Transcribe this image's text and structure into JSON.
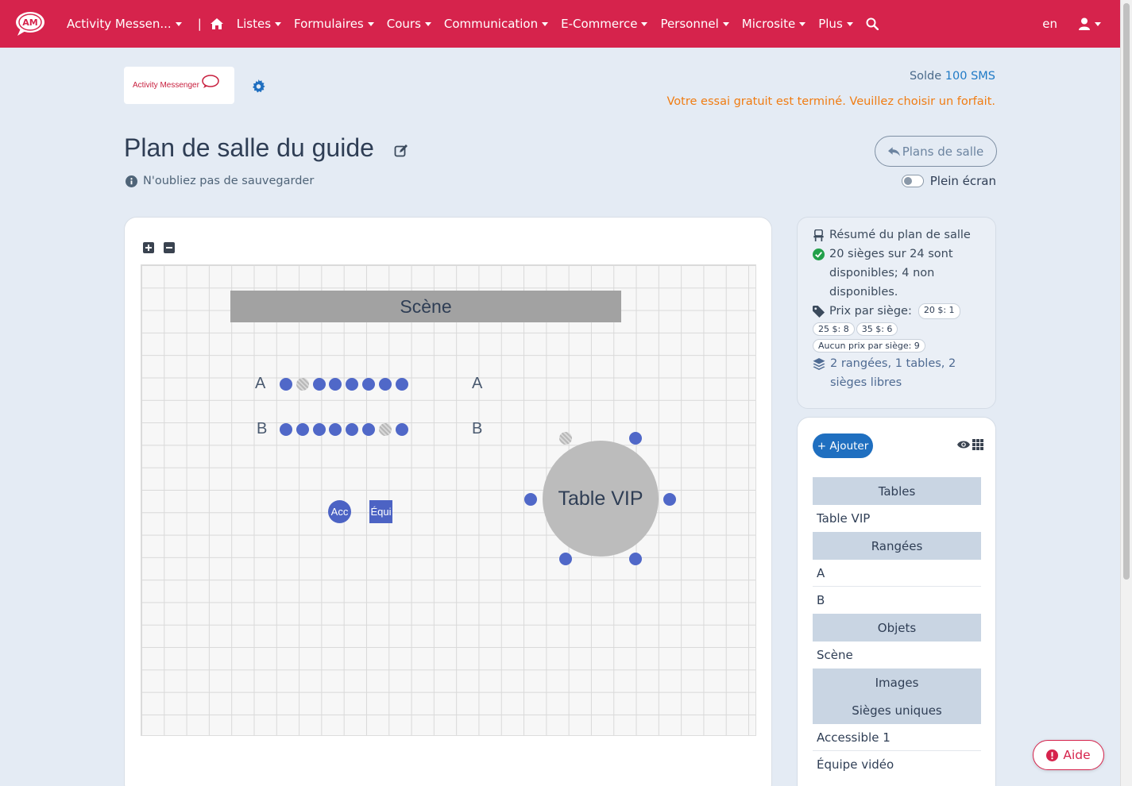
{
  "nav": {
    "logo_text": "AM",
    "app_name": "Activity Messen...",
    "separator": "|",
    "items": [
      "Listes",
      "Formulaires",
      "Cours",
      "Communication",
      "E-Commerce",
      "Personnel",
      "Microsite",
      "Plus"
    ],
    "lang": "en"
  },
  "header": {
    "brand": "Activity Messenger",
    "solde_label": "Solde",
    "solde_value": "100 SMS",
    "trial_notice": "Votre essai gratuit est terminé. Veuillez choisir un forfait.",
    "title": "Plan de salle du guide",
    "save_hint": "N'oubliez pas de sauvegarder",
    "back_button": "Plans de salle",
    "fullscreen_label": "Plein écran"
  },
  "canvas": {
    "stage_label": "Scène",
    "row_a": "A",
    "row_b": "B",
    "row_a_seats": [
      "available",
      "unavailable",
      "available",
      "available",
      "available",
      "available",
      "available",
      "available"
    ],
    "row_b_seats": [
      "available",
      "available",
      "available",
      "available",
      "available",
      "available",
      "unavailable",
      "available"
    ],
    "table_label": "Table VIP",
    "single_accessible": "Acc",
    "single_video": "Équi"
  },
  "summary": {
    "title": "Résumé du plan de salle",
    "availability": "20 sièges sur 24 sont disponibles; 4 non disponibles.",
    "price_label": "Prix par siège:",
    "price_badges": [
      "20 $: 1",
      "25 $: 8",
      "35 $: 6",
      "Aucun prix par siège: 9"
    ],
    "counts_link": "2 rangées, 1 tables, 2 sièges libres"
  },
  "elements": {
    "add_button": "+ Ajouter",
    "tables_header": "Tables",
    "tables": [
      "Table VIP"
    ],
    "rows_header": "Rangées",
    "rows": [
      "A",
      "B"
    ],
    "objects_header": "Objets",
    "objects": [
      "Scène"
    ],
    "images_header": "Images",
    "singles_header": "Sièges uniques",
    "singles": [
      "Accessible 1",
      "Équipe vidéo"
    ]
  },
  "help_button": "Aide",
  "colors": {
    "navbar": "#d6234c",
    "seat_available": "#5068c8",
    "seat_unavailable": "#b8b8b8",
    "accent_blue": "#1f7ac6",
    "warning_orange": "#f07c12"
  }
}
